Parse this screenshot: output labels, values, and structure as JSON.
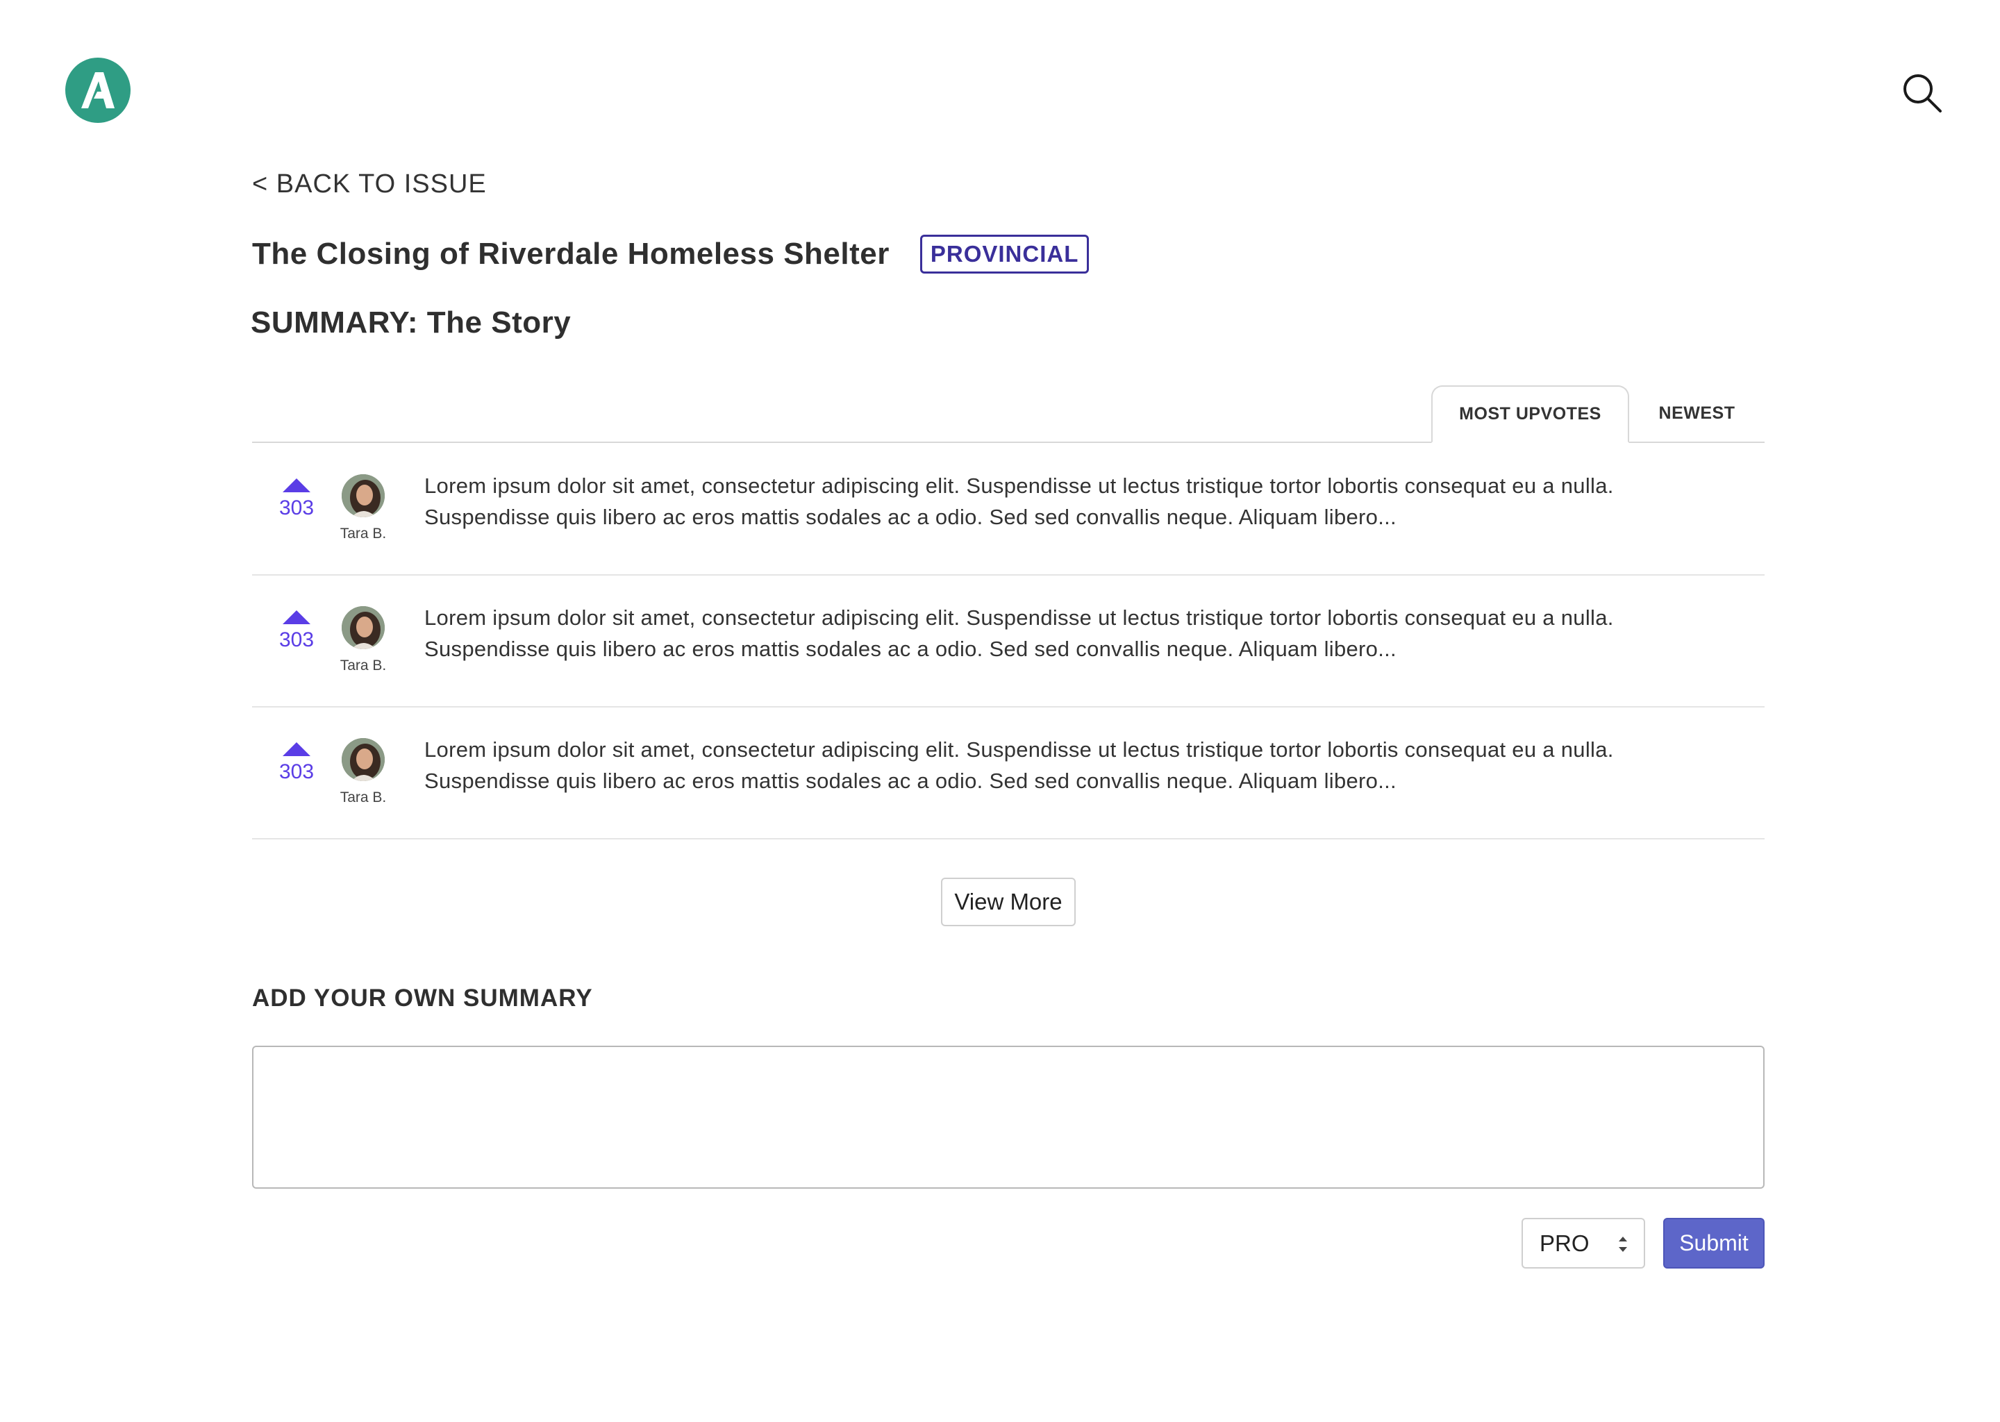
{
  "header": {
    "logo_icon": "a-letter-logo",
    "logo_color": "#2f9d84",
    "search_icon": "search-icon"
  },
  "nav": {
    "back_label": "< BACK TO ISSUE"
  },
  "issue": {
    "title": "The Closing of Riverdale Homeless Shelter",
    "badge": "PROVINCIAL",
    "badge_color": "#3a2f9a"
  },
  "summary_section": {
    "title": "SUMMARY: The Story"
  },
  "tabs": [
    {
      "label": "MOST UPVOTES",
      "active": true
    },
    {
      "label": "NEWEST",
      "active": false
    }
  ],
  "summaries": [
    {
      "votes": "303",
      "author": "Tara B.",
      "text": "Lorem ipsum dolor sit amet, consectetur adipiscing elit. Suspendisse ut lectus tristique tortor lobortis consequat eu a nulla. Suspendisse quis libero ac eros mattis sodales ac a odio. Sed sed convallis neque. Aliquam libero..."
    },
    {
      "votes": "303",
      "author": "Tara B.",
      "text": "Lorem ipsum dolor sit amet, consectetur adipiscing elit. Suspendisse ut lectus tristique tortor lobortis consequat eu a nulla. Suspendisse quis libero ac eros mattis sodales ac a odio. Sed sed convallis neque. Aliquam libero..."
    },
    {
      "votes": "303",
      "author": "Tara B.",
      "text": "Lorem ipsum dolor sit amet, consectetur adipiscing elit. Suspendisse ut lectus tristique tortor lobortis consequat eu a nulla. Suspendisse quis libero ac eros mattis sodales ac a odio. Sed sed convallis neque. Aliquam libero..."
    }
  ],
  "view_more_label": "View More",
  "add_summary": {
    "title": "ADD YOUR OWN SUMMARY",
    "input_value": "",
    "stance_value": "PRO",
    "submit_label": "Submit",
    "submit_color": "#5d66c9"
  },
  "colors": {
    "upvote": "#5a3de6"
  }
}
